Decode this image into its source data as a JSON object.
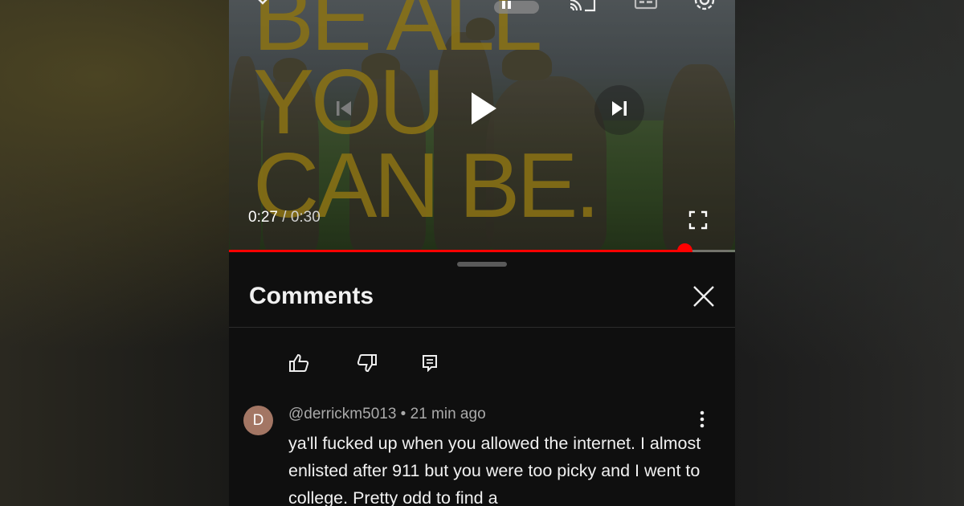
{
  "video": {
    "slogan": "BE ALL\nYOU\nCAN BE.",
    "current_time": "0:27",
    "separator": " / ",
    "duration": "0:30",
    "progress": 0.9,
    "colors": {
      "progress": "#ff0000",
      "slogan": "#8c7314"
    }
  },
  "icons": {
    "collapse": "chevron-down-icon",
    "autoplay": "autoplay-toggle-icon",
    "cast": "cast-icon",
    "captions": "captions-icon",
    "settings": "gear-icon",
    "previous": "previous-icon",
    "play": "play-icon",
    "next": "next-icon",
    "fullscreen": "fullscreen-icon",
    "close": "close-icon",
    "like": "thumbs-up-icon",
    "dislike": "thumbs-down-icon",
    "reply": "reply-icon",
    "more": "more-vertical-icon"
  },
  "comments": {
    "title": "Comments",
    "items": [
      {
        "avatar_letter": "D",
        "author": "@derrickm5013",
        "meta_sep": " • ",
        "time": "21 min ago",
        "text": "ya'll fucked up when you allowed the internet. I almost enlisted after 911 but you were too picky and I went to college. Pretty odd to find a",
        "avatar_color": "#a37664"
      }
    ]
  }
}
